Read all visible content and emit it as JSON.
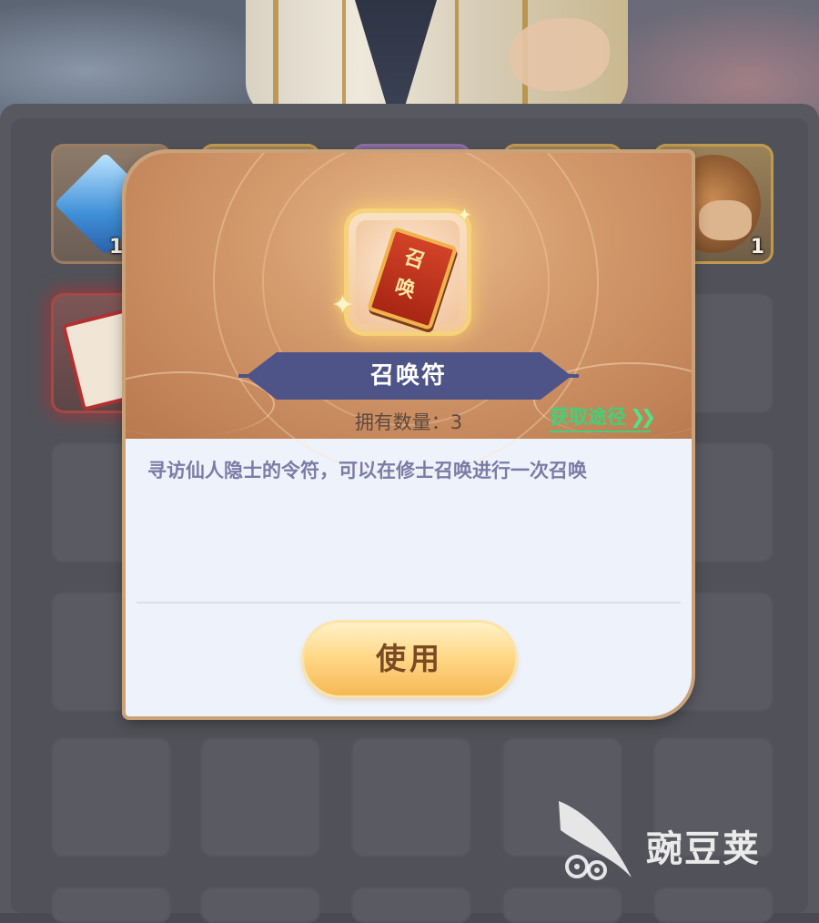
{
  "inventory": {
    "slots": [
      {
        "type": "gem",
        "count": "1"
      },
      {
        "type": "empty"
      },
      {
        "type": "empty"
      },
      {
        "type": "empty"
      },
      {
        "type": "monkey",
        "count": "1"
      }
    ]
  },
  "modal": {
    "item_icon": "summon-talisman-icon",
    "talisman_glyphs": "召唤",
    "item_name": "召唤符",
    "owned_count": "拥有数量：3",
    "obtain_link": "获取途径",
    "description": "寻访仙人隐士的令符，可以在修士召唤进行一次召唤",
    "use_button": "使用"
  },
  "watermark": {
    "text": "豌豆荚"
  },
  "colors": {
    "banner": "#4f5488",
    "link_green": "#3fd27a",
    "button_gold": "#f6b855",
    "panel_bg": "#eef2fb"
  }
}
